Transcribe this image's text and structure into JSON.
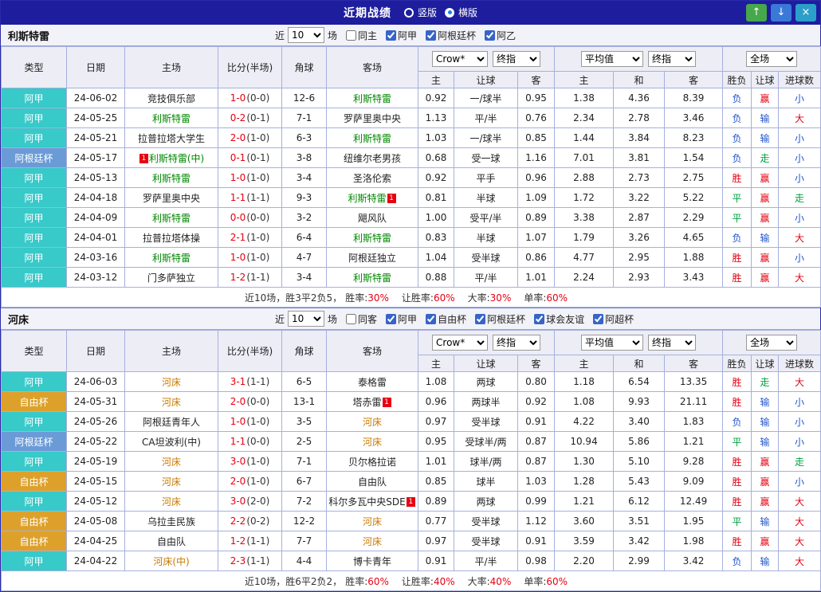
{
  "titlebar": {
    "title": "近期战绩",
    "radios": [
      {
        "label": "竖版",
        "selected": false
      },
      {
        "label": "横版",
        "selected": true
      }
    ],
    "buttons": {
      "up": "↑",
      "down": "↓",
      "close": "×"
    }
  },
  "filter": {
    "near": "近",
    "count": "10",
    "games": "场"
  },
  "table_head": {
    "main": [
      "类型",
      "日期",
      "主场",
      "比分(半场)",
      "角球",
      "客场"
    ],
    "sub": [
      "主",
      "让球",
      "客",
      "主",
      "和",
      "客",
      "胜负",
      "让球",
      "进球数"
    ],
    "selects": {
      "group1": [
        "Crow*",
        "终指"
      ],
      "group2": [
        "平均值",
        "终指"
      ],
      "group3": [
        "全场"
      ]
    }
  },
  "type_colors": {
    "阿甲": "#38c9c9",
    "阿根廷杯": "#6b9bd7",
    "自由杯": "#dda12b"
  },
  "sections": [
    {
      "team": "利斯特雷",
      "team_color": "#008800",
      "same_checkbox": {
        "label": "同主",
        "checked": false
      },
      "league_checkboxes": [
        {
          "label": "阿甲",
          "checked": true
        },
        {
          "label": "阿根廷杯",
          "checked": true
        },
        {
          "label": "阿乙",
          "checked": true
        }
      ],
      "rows": [
        {
          "league": "阿甲",
          "date": "24-06-02",
          "home": "竞技俱乐部",
          "home_focus": false,
          "home_badge": "",
          "score": "1-0",
          "half": "(0-0)",
          "corner": "12-6",
          "away": "利斯特雷",
          "away_focus": true,
          "away_badge": "",
          "ah_home": "0.92",
          "ah_line": "一/球半",
          "ah_away": "0.95",
          "eu_home": "1.38",
          "eu_draw": "4.36",
          "eu_away": "8.39",
          "res_wdl": "负",
          "res_ah": "赢",
          "res_ou": "小"
        },
        {
          "league": "阿甲",
          "date": "24-05-25",
          "home": "利斯特雷",
          "home_focus": true,
          "home_badge": "",
          "score": "0-2",
          "half": "(0-1)",
          "corner": "7-1",
          "away": "罗萨里奥中央",
          "away_focus": false,
          "away_badge": "",
          "ah_home": "1.13",
          "ah_line": "平/半",
          "ah_away": "0.76",
          "eu_home": "2.34",
          "eu_draw": "2.78",
          "eu_away": "3.46",
          "res_wdl": "负",
          "res_ah": "输",
          "res_ou": "大"
        },
        {
          "league": "阿甲",
          "date": "24-05-21",
          "home": "拉普拉塔大学生",
          "home_focus": false,
          "home_badge": "",
          "score": "2-0",
          "half": "(1-0)",
          "corner": "6-3",
          "away": "利斯特雷",
          "away_focus": true,
          "away_badge": "",
          "ah_home": "1.03",
          "ah_line": "一/球半",
          "ah_away": "0.85",
          "eu_home": "1.44",
          "eu_draw": "3.84",
          "eu_away": "8.23",
          "res_wdl": "负",
          "res_ah": "输",
          "res_ou": "小"
        },
        {
          "league": "阿根廷杯",
          "date": "24-05-17",
          "home": "利斯特雷(中)",
          "home_focus": true,
          "home_badge": "before",
          "score": "0-1",
          "half": "(0-1)",
          "corner": "3-8",
          "away": "纽维尔老男孩",
          "away_focus": false,
          "away_badge": "",
          "ah_home": "0.68",
          "ah_line": "受一球",
          "ah_away": "1.16",
          "eu_home": "7.01",
          "eu_draw": "3.81",
          "eu_away": "1.54",
          "res_wdl": "负",
          "res_ah": "走",
          "res_ou": "小"
        },
        {
          "league": "阿甲",
          "date": "24-05-13",
          "home": "利斯特雷",
          "home_focus": true,
          "home_badge": "",
          "score": "1-0",
          "half": "(1-0)",
          "corner": "3-4",
          "away": "圣洛伦索",
          "away_focus": false,
          "away_badge": "",
          "ah_home": "0.92",
          "ah_line": "平手",
          "ah_away": "0.96",
          "eu_home": "2.88",
          "eu_draw": "2.73",
          "eu_away": "2.75",
          "res_wdl": "胜",
          "res_ah": "赢",
          "res_ou": "小"
        },
        {
          "league": "阿甲",
          "date": "24-04-18",
          "home": "罗萨里奥中央",
          "home_focus": false,
          "home_badge": "",
          "score": "1-1",
          "half": "(1-1)",
          "corner": "9-3",
          "away": "利斯特雷",
          "away_focus": true,
          "away_badge": "after",
          "ah_home": "0.81",
          "ah_line": "半球",
          "ah_away": "1.09",
          "eu_home": "1.72",
          "eu_draw": "3.22",
          "eu_away": "5.22",
          "res_wdl": "平",
          "res_ah": "赢",
          "res_ou": "走"
        },
        {
          "league": "阿甲",
          "date": "24-04-09",
          "home": "利斯特雷",
          "home_focus": true,
          "home_badge": "",
          "score": "0-0",
          "half": "(0-0)",
          "corner": "3-2",
          "away": "飓风队",
          "away_focus": false,
          "away_badge": "",
          "ah_home": "1.00",
          "ah_line": "受平/半",
          "ah_away": "0.89",
          "eu_home": "3.38",
          "eu_draw": "2.87",
          "eu_away": "2.29",
          "res_wdl": "平",
          "res_ah": "赢",
          "res_ou": "小"
        },
        {
          "league": "阿甲",
          "date": "24-04-01",
          "home": "拉普拉塔体操",
          "home_focus": false,
          "home_badge": "",
          "score": "2-1",
          "half": "(1-0)",
          "corner": "6-4",
          "away": "利斯特雷",
          "away_focus": true,
          "away_badge": "",
          "ah_home": "0.83",
          "ah_line": "半球",
          "ah_away": "1.07",
          "eu_home": "1.79",
          "eu_draw": "3.26",
          "eu_away": "4.65",
          "res_wdl": "负",
          "res_ah": "输",
          "res_ou": "大"
        },
        {
          "league": "阿甲",
          "date": "24-03-16",
          "home": "利斯特雷",
          "home_focus": true,
          "home_badge": "",
          "score": "1-0",
          "half": "(1-0)",
          "corner": "4-7",
          "away": "阿根廷独立",
          "away_focus": false,
          "away_badge": "",
          "ah_home": "1.04",
          "ah_line": "受半球",
          "ah_away": "0.86",
          "eu_home": "4.77",
          "eu_draw": "2.95",
          "eu_away": "1.88",
          "res_wdl": "胜",
          "res_ah": "赢",
          "res_ou": "小"
        },
        {
          "league": "阿甲",
          "date": "24-03-12",
          "home": "门多萨独立",
          "home_focus": false,
          "home_badge": "",
          "score": "1-2",
          "half": "(1-1)",
          "corner": "3-4",
          "away": "利斯特雷",
          "away_focus": true,
          "away_badge": "",
          "ah_home": "0.88",
          "ah_line": "平/半",
          "ah_away": "1.01",
          "eu_home": "2.24",
          "eu_draw": "2.93",
          "eu_away": "3.43",
          "res_wdl": "胜",
          "res_ah": "赢",
          "res_ou": "大"
        }
      ],
      "summary": {
        "prefix": "近10场，胜3平2负5，",
        "stats": [
          {
            "label": "胜率:",
            "value": "30%"
          },
          {
            "label": "让胜率:",
            "value": "60%"
          },
          {
            "label": "大率:",
            "value": "30%"
          },
          {
            "label": "单率:",
            "value": "60%"
          }
        ]
      }
    },
    {
      "team": "河床",
      "team_color": "#c87a00",
      "same_checkbox": {
        "label": "同客",
        "checked": false
      },
      "league_checkboxes": [
        {
          "label": "阿甲",
          "checked": true
        },
        {
          "label": "自由杯",
          "checked": true
        },
        {
          "label": "阿根廷杯",
          "checked": true
        },
        {
          "label": "球会友谊",
          "checked": true
        },
        {
          "label": "阿超杯",
          "checked": true
        }
      ],
      "rows": [
        {
          "league": "阿甲",
          "date": "24-06-03",
          "home": "河床",
          "home_focus": true,
          "home_badge": "",
          "score": "3-1",
          "half": "(1-1)",
          "corner": "6-5",
          "away": "泰格雷",
          "away_focus": false,
          "away_badge": "",
          "ah_home": "1.08",
          "ah_line": "两球",
          "ah_away": "0.80",
          "eu_home": "1.18",
          "eu_draw": "6.54",
          "eu_away": "13.35",
          "res_wdl": "胜",
          "res_ah": "走",
          "res_ou": "大"
        },
        {
          "league": "自由杯",
          "date": "24-05-31",
          "home": "河床",
          "home_focus": true,
          "home_badge": "",
          "score": "2-0",
          "half": "(0-0)",
          "corner": "13-1",
          "away": "塔赤雷",
          "away_focus": false,
          "away_badge": "after",
          "ah_home": "0.96",
          "ah_line": "两球半",
          "ah_away": "0.92",
          "eu_home": "1.08",
          "eu_draw": "9.93",
          "eu_away": "21.11",
          "res_wdl": "胜",
          "res_ah": "输",
          "res_ou": "小"
        },
        {
          "league": "阿甲",
          "date": "24-05-26",
          "home": "阿根廷青年人",
          "home_focus": false,
          "home_badge": "",
          "score": "1-0",
          "half": "(1-0)",
          "corner": "3-5",
          "away": "河床",
          "away_focus": true,
          "away_badge": "",
          "ah_home": "0.97",
          "ah_line": "受半球",
          "ah_away": "0.91",
          "eu_home": "4.22",
          "eu_draw": "3.40",
          "eu_away": "1.83",
          "res_wdl": "负",
          "res_ah": "输",
          "res_ou": "小"
        },
        {
          "league": "阿根廷杯",
          "date": "24-05-22",
          "home": "CA坦波利(中)",
          "home_focus": false,
          "home_badge": "",
          "score": "1-1",
          "half": "(0-0)",
          "corner": "2-5",
          "away": "河床",
          "away_focus": true,
          "away_badge": "",
          "ah_home": "0.95",
          "ah_line": "受球半/两",
          "ah_away": "0.87",
          "eu_home": "10.94",
          "eu_draw": "5.86",
          "eu_away": "1.21",
          "res_wdl": "平",
          "res_ah": "输",
          "res_ou": "小"
        },
        {
          "league": "阿甲",
          "date": "24-05-19",
          "home": "河床",
          "home_focus": true,
          "home_badge": "",
          "score": "3-0",
          "half": "(1-0)",
          "corner": "7-1",
          "away": "贝尔格拉诺",
          "away_focus": false,
          "away_badge": "",
          "ah_home": "1.01",
          "ah_line": "球半/两",
          "ah_away": "0.87",
          "eu_home": "1.30",
          "eu_draw": "5.10",
          "eu_away": "9.28",
          "res_wdl": "胜",
          "res_ah": "赢",
          "res_ou": "走"
        },
        {
          "league": "自由杯",
          "date": "24-05-15",
          "home": "河床",
          "home_focus": true,
          "home_badge": "",
          "score": "2-0",
          "half": "(1-0)",
          "corner": "6-7",
          "away": "自由队",
          "away_focus": false,
          "away_badge": "",
          "ah_home": "0.85",
          "ah_line": "球半",
          "ah_away": "1.03",
          "eu_home": "1.28",
          "eu_draw": "5.43",
          "eu_away": "9.09",
          "res_wdl": "胜",
          "res_ah": "赢",
          "res_ou": "小"
        },
        {
          "league": "阿甲",
          "date": "24-05-12",
          "home": "河床",
          "home_focus": true,
          "home_badge": "",
          "score": "3-0",
          "half": "(2-0)",
          "corner": "7-2",
          "away": "科尔多瓦中央SDE",
          "away_focus": false,
          "away_badge": "after",
          "ah_home": "0.89",
          "ah_line": "两球",
          "ah_away": "0.99",
          "eu_home": "1.21",
          "eu_draw": "6.12",
          "eu_away": "12.49",
          "res_wdl": "胜",
          "res_ah": "赢",
          "res_ou": "大"
        },
        {
          "league": "自由杯",
          "date": "24-05-08",
          "home": "乌拉圭民族",
          "home_focus": false,
          "home_badge": "",
          "score": "2-2",
          "half": "(0-2)",
          "corner": "12-2",
          "away": "河床",
          "away_focus": true,
          "away_badge": "",
          "ah_home": "0.77",
          "ah_line": "受半球",
          "ah_away": "1.12",
          "eu_home": "3.60",
          "eu_draw": "3.51",
          "eu_away": "1.95",
          "res_wdl": "平",
          "res_ah": "输",
          "res_ou": "大"
        },
        {
          "league": "自由杯",
          "date": "24-04-25",
          "home": "自由队",
          "home_focus": false,
          "home_badge": "",
          "score": "1-2",
          "half": "(1-1)",
          "corner": "7-7",
          "away": "河床",
          "away_focus": true,
          "away_badge": "",
          "ah_home": "0.97",
          "ah_line": "受半球",
          "ah_away": "0.91",
          "eu_home": "3.59",
          "eu_draw": "3.42",
          "eu_away": "1.98",
          "res_wdl": "胜",
          "res_ah": "赢",
          "res_ou": "大"
        },
        {
          "league": "阿甲",
          "date": "24-04-22",
          "home": "河床(中)",
          "home_focus": true,
          "home_badge": "",
          "score": "2-3",
          "half": "(1-1)",
          "corner": "4-4",
          "away": "博卡青年",
          "away_focus": false,
          "away_badge": "",
          "ah_home": "0.91",
          "ah_line": "平/半",
          "ah_away": "0.98",
          "eu_home": "2.20",
          "eu_draw": "2.99",
          "eu_away": "3.42",
          "res_wdl": "负",
          "res_ah": "输",
          "res_ou": "大"
        }
      ],
      "summary": {
        "prefix": "近10场，胜6平2负2，",
        "stats": [
          {
            "label": "胜率:",
            "value": "60%"
          },
          {
            "label": "让胜率:",
            "value": "40%"
          },
          {
            "label": "大率:",
            "value": "40%"
          },
          {
            "label": "单率:",
            "value": "60%"
          }
        ]
      }
    }
  ]
}
